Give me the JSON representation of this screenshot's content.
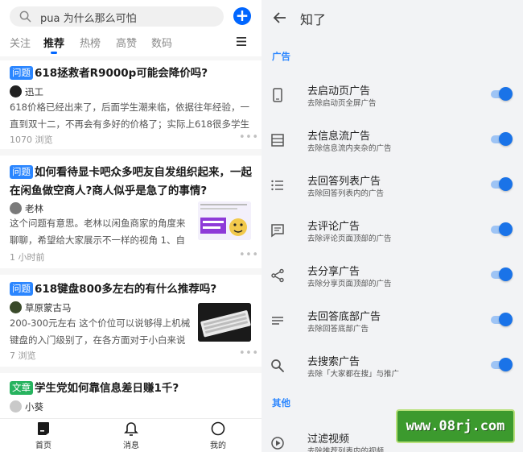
{
  "feed": {
    "search_text": "pua 为什么那么可怕",
    "plus_label": "+",
    "tabs": [
      "关注",
      "推荐",
      "热榜",
      "高赞",
      "数码"
    ],
    "cards": [
      {
        "tag": "问题",
        "title": "618拯救者R9000p可能会降价吗?",
        "author": "迅工",
        "excerpt": "618价格已经出来了，后面学生潮来临，依据往年经验，一直到双十二，不再会有多好的价格了；实际上618很多学生还没确...",
        "meta": "1070 浏览"
      },
      {
        "tag": "问题",
        "title": "如何看待显卡吧众多吧友自发组织起来，一起在闲鱼做空商人?商人似乎是急了的事情?",
        "author": "老林",
        "excerpt": "这个问题有意思。老林以闲鱼商家的角度来聊聊，希望给大家展示不一样的视角 1、自发组...",
        "meta": "1 小时前"
      },
      {
        "tag": "问题",
        "title": "618键盘800多左右的有什么推荐吗?",
        "author": "草原蒙古马",
        "excerpt": "200-300元左右 这个价位可以说够得上机械键盘的入门级别了，在各方面对于小白来说都能得...",
        "meta": "7 浏览"
      },
      {
        "tag": "文章",
        "title": "学生党如何靠信息差日赚1千?",
        "author": "小葵"
      }
    ],
    "bottom_nav": [
      "首页",
      "消息",
      "我的"
    ],
    "more_dots": "•••"
  },
  "settings": {
    "title": "知了",
    "section_ads": "广告",
    "section_other": "其他",
    "items": [
      {
        "icon": "phone-icon",
        "label": "去启动页广告",
        "sub": "去除启动页全屏广告",
        "on": true
      },
      {
        "icon": "feed-icon",
        "label": "去信息流广告",
        "sub": "去除信息流内夹杂的广告",
        "on": true
      },
      {
        "icon": "list-icon",
        "label": "去回答列表广告",
        "sub": "去除回答列表内的广告",
        "on": true
      },
      {
        "icon": "comment-icon",
        "label": "去评论广告",
        "sub": "去除评论页面顶部的广告",
        "on": true
      },
      {
        "icon": "share-icon",
        "label": "去分享广告",
        "sub": "去除分享页面顶部的广告",
        "on": true
      },
      {
        "icon": "lines-icon",
        "label": "去回答底部广告",
        "sub": "去除回答底部广告",
        "on": true
      },
      {
        "icon": "search-icon",
        "label": "去搜索广告",
        "sub": "去除「大家都在搜」与推广",
        "on": true
      }
    ],
    "other_items": [
      {
        "icon": "play-icon",
        "label": "过滤视频",
        "sub": "去除推荐列表内的视频"
      }
    ]
  },
  "watermark_text": "www.08rj.com",
  "colors": {
    "accent": "#0066ff",
    "tag_blue": "#2b86ff",
    "tag_green": "#27b35f",
    "toggle_on": "#1a73e8"
  }
}
